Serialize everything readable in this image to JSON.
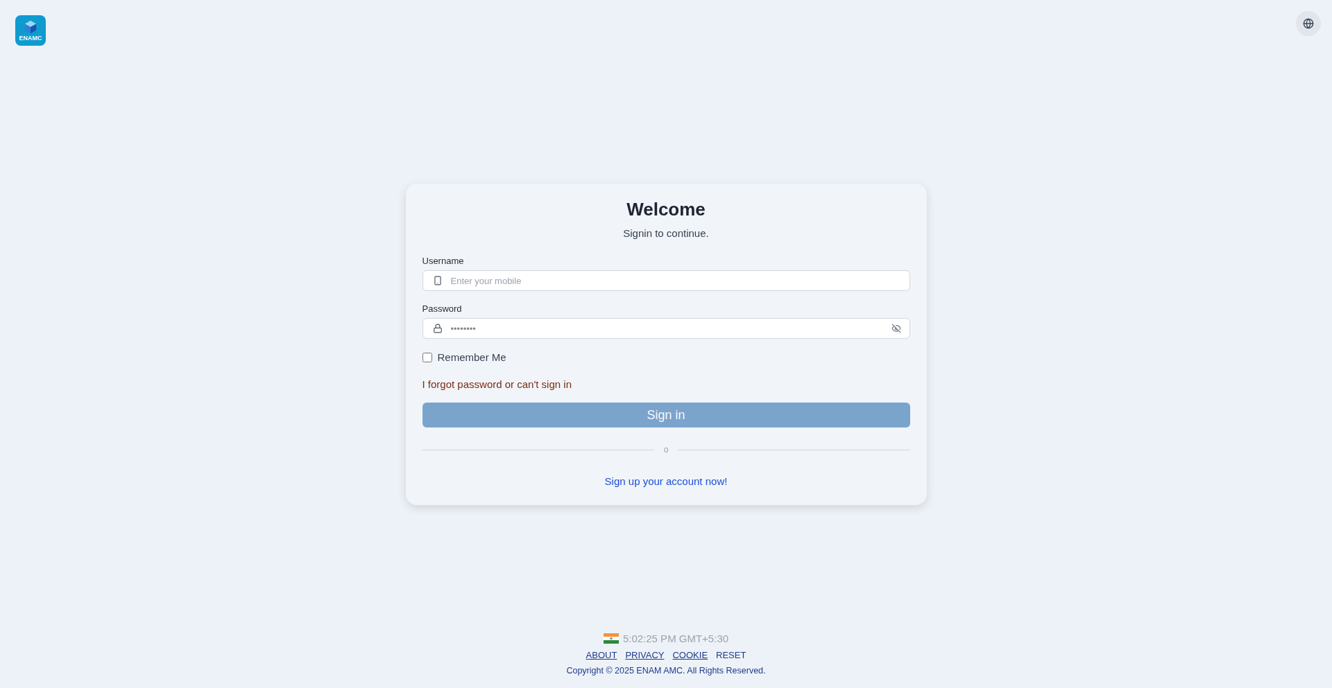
{
  "logo": {
    "text": "ENAMC"
  },
  "card": {
    "title": "Welcome",
    "subtitle": "Signin to continue.",
    "fields": [
      {
        "kind": "mobile",
        "label": "Username",
        "placeholder": "Enter your mobile"
      },
      {
        "kind": "password",
        "label": "Password",
        "value": "••••••••"
      }
    ],
    "remember": {
      "label": "Remember Me",
      "checked": false
    },
    "forgot_link": "I forgot password or can't sign in",
    "submit": {
      "label": "Sign in",
      "disabled": true
    },
    "divider": "o",
    "signup_link": "Sign up your account now!"
  },
  "footer": {
    "time": "5:02:25 PM GMT+5:30",
    "links": [
      {
        "label": "ABOUT",
        "underlined": true
      },
      {
        "label": "PRIVACY",
        "underlined": true
      },
      {
        "label": "COOKIE",
        "underlined": true
      },
      {
        "label": "RESET",
        "underlined": false
      }
    ],
    "copyright": "Copyright © 2025 ENAM AMC. All Rights Reserved."
  }
}
